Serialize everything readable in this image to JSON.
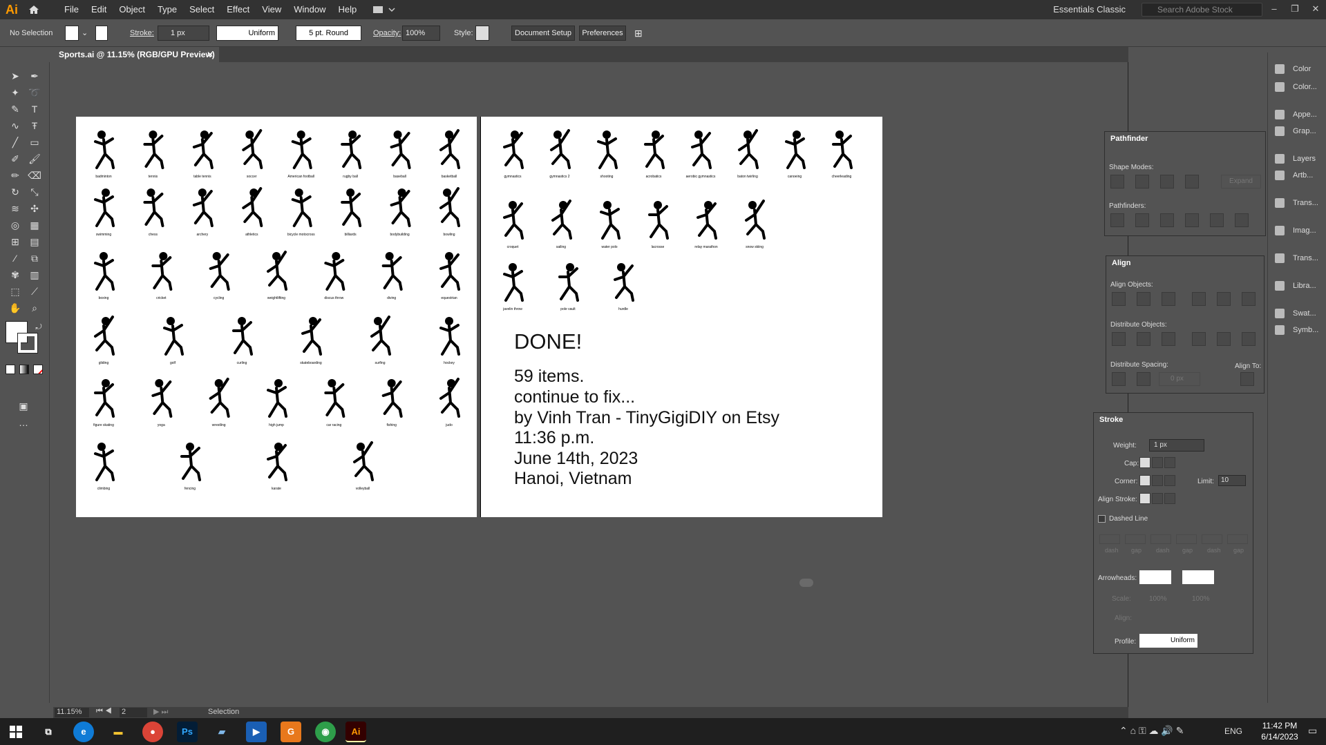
{
  "menubar": {
    "logo": "Ai",
    "items": [
      "File",
      "Edit",
      "Object",
      "Type",
      "Select",
      "Effect",
      "View",
      "Window",
      "Help"
    ],
    "workspace": "Essentials Classic",
    "search_placeholder": "Search Adobe Stock"
  },
  "control": {
    "selection": "No Selection",
    "stroke_label": "Stroke:",
    "stroke_value": "1 px",
    "profile": "Uniform",
    "brush": "5 pt. Round",
    "opacity_label": "Opacity:",
    "opacity_value": "100%",
    "style_label": "Style:",
    "doc_setup": "Document Setup",
    "preferences": "Preferences"
  },
  "document": {
    "tab": "Sports.ai @ 11.15% (RGB/GPU Preview)"
  },
  "artboard1": {
    "labels": [
      "badminton",
      "tennis",
      "table tennis",
      "soccer",
      "American football",
      "rugby ball",
      "baseball",
      "basketball",
      "swimming",
      "chess",
      "archery",
      "athletics",
      "bicycle motocross",
      "billiards",
      "bodybuilding",
      "bowling",
      "boxing",
      "cricket",
      "cycling",
      "weightlifting",
      "discus throw",
      "diving",
      "equestrian",
      "gliding",
      "golf",
      "curling",
      "skateboarding",
      "surfing",
      "hockey",
      "figure skating",
      "yoga",
      "wrestling",
      "high jump",
      "car racing",
      "fishing",
      "judo",
      "climbing",
      "fencing",
      "karate",
      "volleyball"
    ]
  },
  "artboard2": {
    "labels": [
      "gymnastics",
      "gymnastics 2",
      "shooting",
      "acrobatics",
      "aerobic gymnastics",
      "baton twirling",
      "canoeing",
      "cheerleading",
      "croquet",
      "sailing",
      "water polo",
      "lacrosse",
      "relay marathon",
      "snow skiing",
      "javelin throw",
      "pole vault",
      "hurdle"
    ],
    "done": "DONE!",
    "lines": [
      "59 items.",
      "continue to fix...",
      "by Vinh Tran - TinyGigiDIY on Etsy",
      "11:36 p.m.",
      "June 14th, 2023",
      "Hanoi, Vietnam"
    ]
  },
  "status": {
    "zoom": "11.15%",
    "artboard": "2",
    "tool": "Selection"
  },
  "pathfinder": {
    "title": "Pathfinder",
    "shape_modes": "Shape Modes:",
    "expand": "Expand",
    "pathfinders": "Pathfinders:"
  },
  "align": {
    "title": "Align",
    "align_objects": "Align Objects:",
    "distribute_objects": "Distribute Objects:",
    "distribute_spacing": "Distribute Spacing:",
    "align_to": "Align To:",
    "spacing": "0 px"
  },
  "stroke": {
    "title": "Stroke",
    "weight_label": "Weight:",
    "weight": "1 px",
    "cap": "Cap:",
    "corner": "Corner:",
    "limit_label": "Limit:",
    "limit": "10",
    "align_stroke": "Align Stroke:",
    "dashed": "Dashed Line",
    "dash_labels": [
      "dash",
      "gap",
      "dash",
      "gap",
      "dash",
      "gap"
    ],
    "arrowheads": "Arrowheads:",
    "scale": "Scale:",
    "scale1": "100%",
    "scale2": "100%",
    "align": "Align:",
    "profile": "Profile:",
    "profile_value": "Uniform"
  },
  "dock": {
    "items": [
      "Color",
      "Color...",
      "Appe...",
      "Grap...",
      "Layers",
      "Artb...",
      "Trans...",
      "Imag...",
      "Trans...",
      "Libra...",
      "Swat...",
      "Symb..."
    ]
  },
  "taskbar": {
    "lang": "ENG",
    "time": "11:42 PM",
    "date": "6/14/2023"
  }
}
